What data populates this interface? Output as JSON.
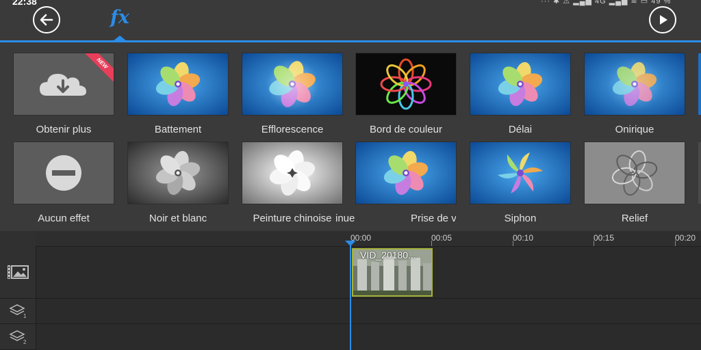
{
  "status": {
    "time": "22:38",
    "indicators": "··· ✱ ⚠ ▂▄▆ 4G ▂▄▆ ≋",
    "battery": "49 %"
  },
  "toolbar": {
    "fx_tab_label": "fx",
    "back_icon": "arrow-left-icon",
    "play_icon": "play-icon"
  },
  "colors": {
    "accent": "#2a8de8",
    "background": "#3a3a3a",
    "timeline_bg": "#2b2b2b",
    "new_ribbon": "#e83e5a",
    "clip_border": "#a6b33c"
  },
  "effects": {
    "row1": [
      {
        "label": "Obtenir plus",
        "badge": "NEW",
        "icon": "cloud-download-icon"
      },
      {
        "label": "Battement"
      },
      {
        "label": "Efflorescence"
      },
      {
        "label": "Bord de couleur"
      },
      {
        "label": "Délai"
      },
      {
        "label": "Onirique"
      }
    ],
    "row2": [
      {
        "label": "Aucun effet",
        "icon": "no-entry-icon"
      },
      {
        "label": "Noir et blanc"
      },
      {
        "label": "Peinture chinoise"
      },
      {
        "label_left": "inue",
        "label_right": "Prise de v"
      },
      {
        "label": "Siphon"
      },
      {
        "label": "Relief"
      }
    ]
  },
  "timeline": {
    "ruler": [
      "00:00",
      "00:05",
      "00:10",
      "00:15",
      "00:20"
    ],
    "tracks": [
      {
        "icon": "image-video-track-icon"
      },
      {
        "icon": "overlay-layer-icon",
        "number": "1"
      },
      {
        "icon": "overlay-layer-icon",
        "number": "2"
      }
    ],
    "clip": {
      "label": "VID_20180..."
    }
  }
}
